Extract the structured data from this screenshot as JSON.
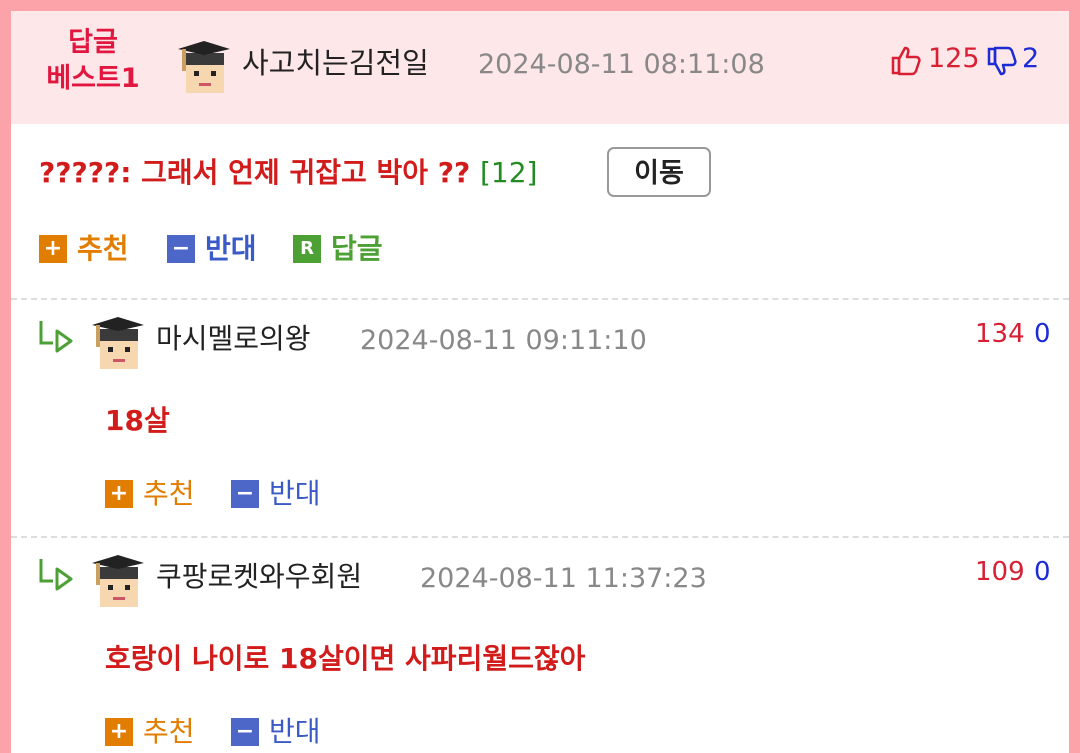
{
  "best": {
    "label_line1": "답글",
    "label_line2": "베스트1",
    "author": "사고치는김전일",
    "date": "2024-08-11 08:11:08",
    "upvotes": "125",
    "downvotes": "2"
  },
  "post": {
    "title": "?????: 그래서 언제 귀잡고 박아 ??",
    "comment_count": "[12]",
    "move_label": "이동"
  },
  "actions": {
    "recommend_icon": "+",
    "recommend_label": "추천",
    "oppose_icon": "−",
    "oppose_label": "반대",
    "reply_icon": "R",
    "reply_label": "답글"
  },
  "replies": [
    {
      "author": "마시멜로의왕",
      "date": "2024-08-11 09:11:10",
      "upvotes": "134",
      "downvotes": "0",
      "body": "18살"
    },
    {
      "author": "쿠팡로켓와우회원",
      "date": "2024-08-11 11:37:23",
      "upvotes": "109",
      "downvotes": "0",
      "body": "호랑이 나이로 18살이면 사파리월드잖아"
    }
  ],
  "icons": {
    "avatar": "graduate-avatar-icon",
    "thumb_up": "thumbs-up-icon",
    "thumb_down": "thumbs-down-icon",
    "reply_arrow": "reply-arrow-icon"
  },
  "colors": {
    "frame": "#fca3aa",
    "header_bg": "#fde7e9",
    "accent_red": "#d21c1c",
    "recommend": "#e17d00",
    "oppose": "#4d67c8",
    "reply": "#4ca034"
  }
}
